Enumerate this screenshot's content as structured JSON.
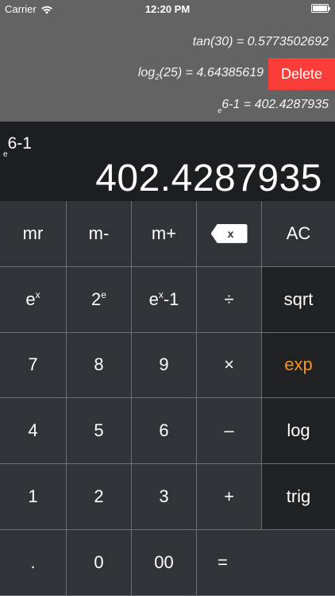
{
  "status_bar": {
    "carrier": "Carrier",
    "time": "12:20 PM"
  },
  "history": [
    {
      "text": "tan(30) = 0.5773502692"
    },
    {
      "main": "log",
      "sub": "2",
      "rest": "(25) = 4.64385619"
    },
    {
      "pre": "e",
      "rest": "6-1 = 402.4287935"
    }
  ],
  "delete_label": "Delete",
  "display": {
    "expr_pre": "e",
    "expr": "6-1",
    "result": "402.4287935"
  },
  "keys": {
    "mr": "mr",
    "m_minus": "m-",
    "m_plus": "m+",
    "ac": "AC",
    "ex_base": "e",
    "ex_sup": "x",
    "two_e_base": "2",
    "two_e_sup": "e",
    "exm1_base": "e",
    "exm1_sup": "x",
    "exm1_rest": "-1",
    "divide": "÷",
    "sqrt": "sqrt",
    "seven": "7",
    "eight": "8",
    "nine": "9",
    "multiply": "×",
    "exp": "exp",
    "four": "4",
    "five": "5",
    "six": "6",
    "minus": "–",
    "log": "log",
    "one": "1",
    "two": "2",
    "three": "3",
    "plus": "+",
    "trig": "trig",
    "dot": ".",
    "zero": "0",
    "double_zero": "00",
    "equals": "=",
    "backspace_glyph": "x"
  },
  "colors": {
    "delete_red": "#fb3d3a",
    "accent_orange": "#f7941e",
    "history_bg": "#636363",
    "display_bg": "#1c1e21"
  }
}
